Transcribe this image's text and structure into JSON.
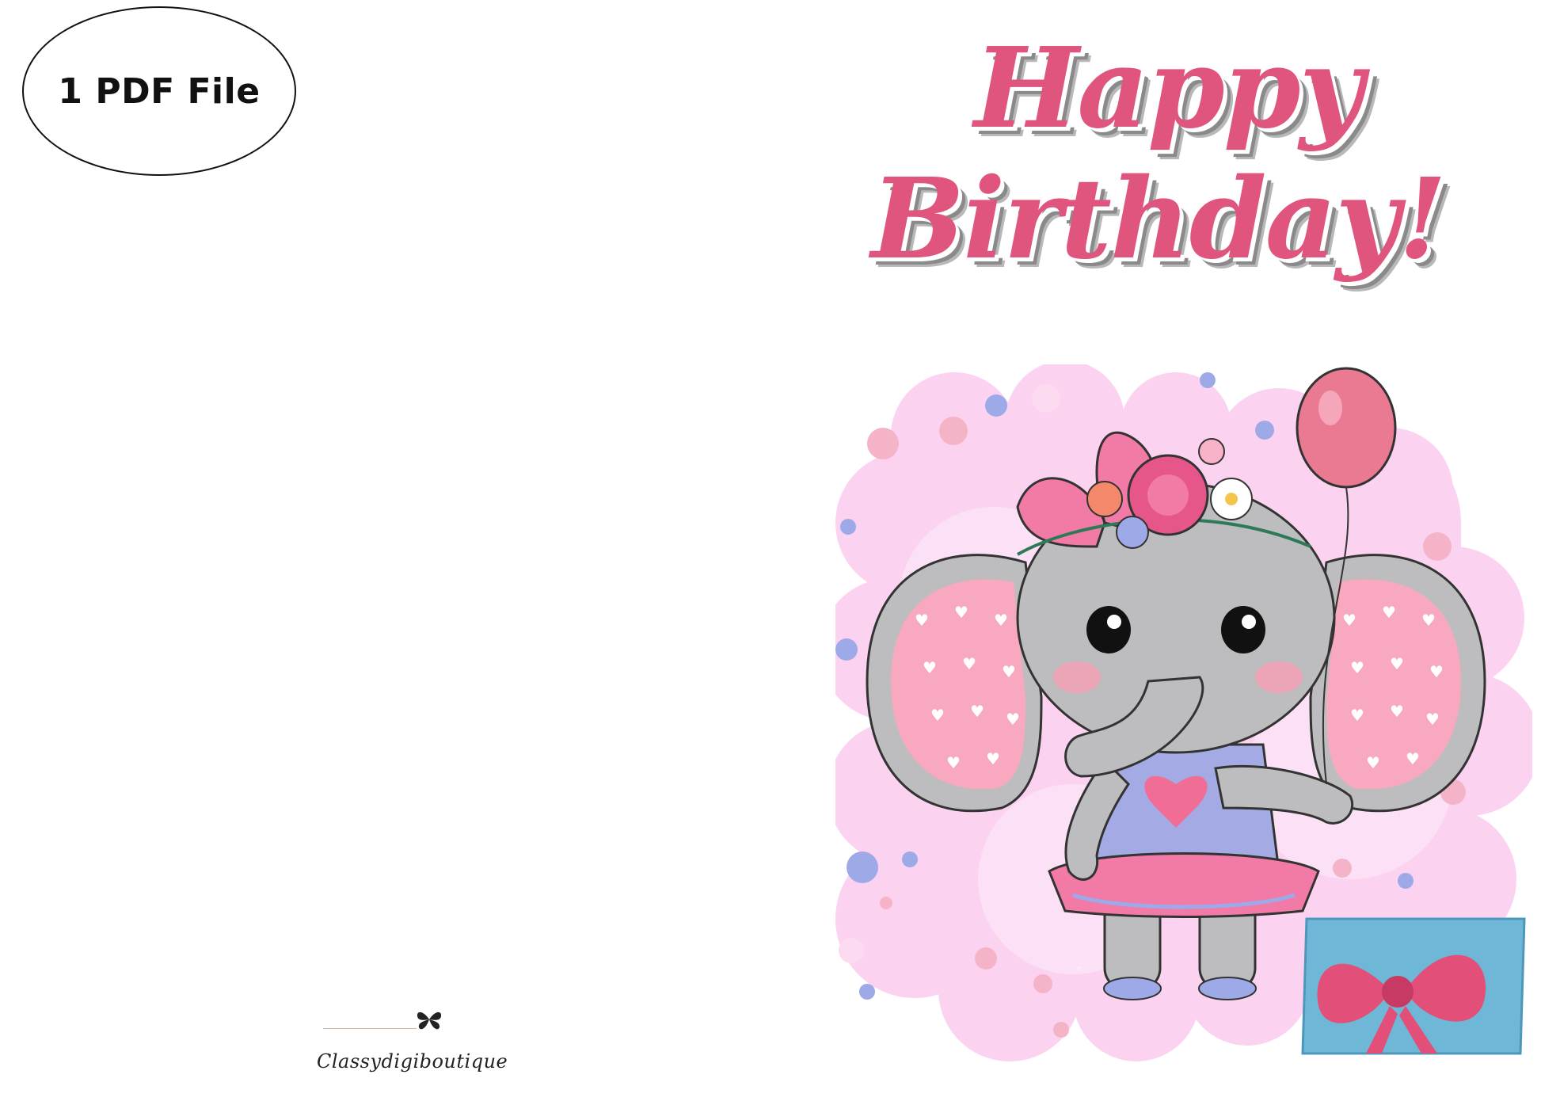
{
  "badge": {
    "label": "1 PDF File"
  },
  "card": {
    "title_line1": "Happy",
    "title_line2": "Birthday!"
  },
  "illustration": {
    "subject": "cartoon elephant with pink bow, flower crown, pink balloon and gift box",
    "colors": {
      "pink_title": "#e0557d",
      "background_blob": "#fbd6f1",
      "elephant_gray": "#bdbdbf",
      "ear_pink": "#f8a8bf",
      "balloon": "#e97a92",
      "gift_blue": "#6fb7d6",
      "dots_blue": "#9ea9e8"
    }
  },
  "brand": {
    "name": "Classydigiboutique",
    "logo_icon": "butterfly-logo-icon"
  }
}
